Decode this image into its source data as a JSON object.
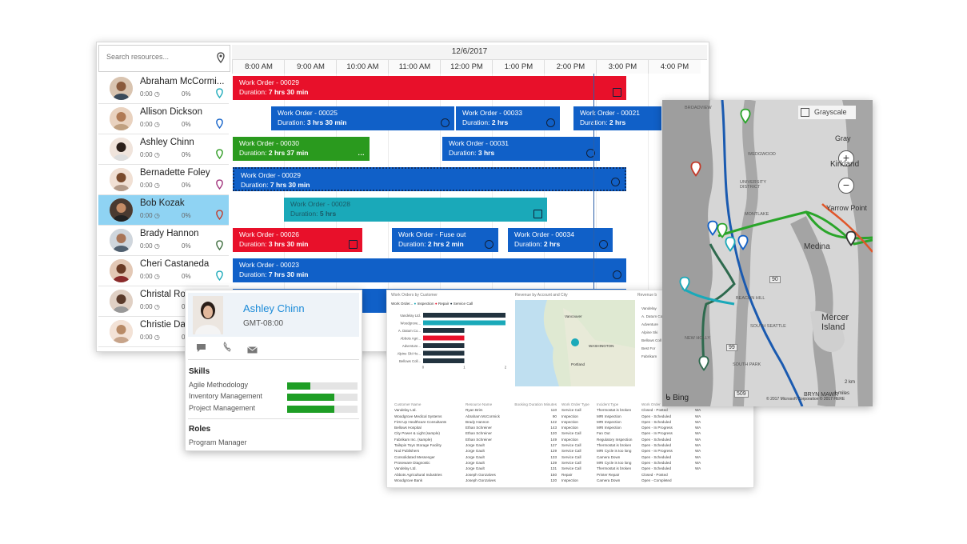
{
  "board": {
    "search_placeholder": "Search resources...",
    "date": "12/6/2017",
    "hours": [
      "8:00 AM",
      "9:00 AM",
      "10:00 AM",
      "11:00 AM",
      "12:00 PM",
      "1:00 PM",
      "2:00 PM",
      "3:00 PM",
      "4:00 PM"
    ],
    "resources": [
      {
        "name": "Abraham McCormi...",
        "hours": "0:00",
        "pct": "0%",
        "pin_color": "#1aa9b9"
      },
      {
        "name": "Allison Dickson",
        "hours": "0:00",
        "pct": "0%",
        "pin_color": "#1060c8"
      },
      {
        "name": "Ashley Chinn",
        "hours": "0:00",
        "pct": "0%",
        "pin_color": "#2a9a1e"
      },
      {
        "name": "Bernadette Foley",
        "hours": "0:00",
        "pct": "0%",
        "pin_color": "#a0307a"
      },
      {
        "name": "Bob Kozak",
        "hours": "0:00",
        "pct": "0%",
        "pin_color": "#c23a2a"
      },
      {
        "name": "Brady Hannon",
        "hours": "0:00",
        "pct": "0%",
        "pin_color": "#3a6a3a"
      },
      {
        "name": "Cheri Castaneda",
        "hours": "0:00",
        "pct": "0%",
        "pin_color": "#1aa9b9"
      },
      {
        "name": "Christal Rob",
        "hours": "0:00",
        "pct": "0%",
        "pin_color": "#1060c8"
      },
      {
        "name": "Christie Day",
        "hours": "0:00",
        "pct": "0%",
        "pin_color": "#1060c8"
      }
    ],
    "bookings": [
      {
        "title": "Work Order - 00029",
        "duration_label": "Duration:",
        "duration": "7 hrs 30 min"
      },
      {
        "title": "Work Order - 00025",
        "duration_label": "Duration:",
        "duration": "3 hrs 30 min"
      },
      {
        "title": "Work Order - 00033",
        "duration_label": "Duration:",
        "duration": "2 hrs"
      },
      {
        "title": "Work Order - 00021",
        "duration_label": "Duration:",
        "duration": "2 hrs"
      },
      {
        "title": "Work Order - 00030",
        "duration_label": "Duration:",
        "duration": "2 hrs 37 min"
      },
      {
        "title": "Work Order - 00031",
        "duration_label": "Duration:",
        "duration": "3 hrs"
      },
      {
        "title": "Work Order - 00029",
        "duration_label": "Duration:",
        "duration": "7 hrs 30 min"
      },
      {
        "title": "Work Order - 00028",
        "duration_label": "Duration:",
        "duration": "5 hrs"
      },
      {
        "title": "Work Order - 00026",
        "duration_label": "Duration:",
        "duration": "3 hrs 30 min"
      },
      {
        "title": "Work Order - Fuse out",
        "duration_label": "Duration:",
        "duration": "2 hrs 2 min"
      },
      {
        "title": "Work Order - 00034",
        "duration_label": "Duration:",
        "duration": "2 hrs"
      },
      {
        "title": "Work Order - 00023",
        "duration_label": "Duration:",
        "duration": "7 hrs 30 min"
      }
    ],
    "colors": {
      "red": "#e8102a",
      "blue": "#1060c8",
      "green": "#2a9a1e",
      "teal": "#1aa9b9",
      "selected_row": "#8fd3f3"
    }
  },
  "card": {
    "name": "Ashley Chinn",
    "timezone": "GMT-08:00",
    "skills_heading": "Skills",
    "skills": [
      {
        "name": "Agile Methodology",
        "level": 0.33
      },
      {
        "name": "Inventory Management",
        "level": 0.67
      },
      {
        "name": "Project Management",
        "level": 0.67
      }
    ],
    "roles_heading": "Roles",
    "roles": [
      "Program Manager"
    ],
    "icons": [
      "chat-icon",
      "phone-icon",
      "mail-icon"
    ]
  },
  "report": {
    "chart1_title": "Work Orders by Customer",
    "legend_label": "Work Order...",
    "legend": [
      {
        "name": "Inspection",
        "color": "#1aa9b9"
      },
      {
        "name": "Repair",
        "color": "#e8102a"
      },
      {
        "name": "Service Call",
        "color": "#22333f"
      }
    ],
    "chart_data": {
      "type": "bar",
      "orientation": "horizontal",
      "categories": [
        "Vandelay Ltd.",
        "Woodgrove...",
        "A. Datum Co...",
        "Abbots Agri...",
        "Adventure...",
        "Alpine Ski Ho...",
        "Bellows Coll..."
      ],
      "values": [
        2,
        2,
        1,
        1,
        1,
        1,
        1
      ],
      "colors": [
        "#22333f",
        "#1aa9b9",
        "#22333f",
        "#e8102a",
        "#22333f",
        "#22333f",
        "#22333f"
      ],
      "xticks": [
        "0",
        "1",
        "2"
      ],
      "xlim": [
        0,
        2
      ]
    },
    "chart2_title": "Revenue by Account and City",
    "chart3_title": "Revenue b",
    "map_labels": [
      "Vancouver",
      "WASHINGTON",
      "Portland"
    ],
    "right_list": [
      "Vandelay",
      "A. Datum Co",
      "Adventure",
      "Alpine Ski",
      "Bellows Coll",
      "Best For",
      "Fabrikam"
    ],
    "table_headers": [
      "Customer Name",
      "Resource Name",
      "Booking Duration Minutes",
      "Work Order Type",
      "Incident Type",
      "Work Order"
    ],
    "table_rows": [
      [
        "Vandelay Ltd.",
        "Ryan Brim",
        "110",
        "Service Call",
        "Thermostat is broken",
        "Closed - Posted",
        ""
      ],
      [
        "Woodgrove Medical Systems",
        "Abraham McCormick",
        "90",
        "Inspection",
        "MRI Inspection",
        "Open - Scheduled",
        ""
      ],
      [
        "First Up Healthcare Consultants",
        "Brady Hannon",
        "122",
        "Inspection",
        "MRI Inspection",
        "Open - Scheduled",
        "WA"
      ],
      [
        "Bellows Hospital",
        "Ethan Schreiner",
        "143",
        "Inspection",
        "MRI Inspection",
        "Open - In Progress",
        "WA"
      ],
      [
        "City Power & Light (sample)",
        "Ethan Schreiner",
        "120",
        "Service Call",
        "Fan Out",
        "Open - In Progress",
        "WA"
      ],
      [
        "Fabrikam Inc. (sample)",
        "Ethan Schreiner",
        "149",
        "Inspection",
        "Regulatory Inspection",
        "Open - Scheduled",
        "WA"
      ],
      [
        "Tailspin Toys Storage Facility",
        "Jorge Gault",
        "127",
        "Service Call",
        "Thermostat is broken",
        "Open - Scheduled",
        "WA"
      ],
      [
        "Nod Publishers",
        "Jorge Gault",
        "129",
        "Service Call",
        "MRI Cycle is too long",
        "Open - In Progress",
        "WA"
      ],
      [
        "Consolidated Messenger",
        "Jorge Gault",
        "133",
        "Service Call",
        "Camera Down",
        "Open - Scheduled",
        "WA"
      ],
      [
        "Proseware Diagnostic",
        "Jorge Gault",
        "139",
        "Service Call",
        "MRI Cycle is too long",
        "Open - Scheduled",
        "WA"
      ],
      [
        "Vandelay Ltd.",
        "Jorge Gault",
        "131",
        "Service Call",
        "Thermostat is broken",
        "Open - Scheduled",
        "WA"
      ],
      [
        "Abbots Agricultural Industries",
        "Joseph Gonzalves",
        "150",
        "Repair",
        "Printer Repair",
        "Closed - Posted",
        "WA"
      ],
      [
        "Woodgrove Bank",
        "Joseph Gonzalves",
        "120",
        "Inspection",
        "Camera Down",
        "Open - Completed",
        "WA"
      ]
    ]
  },
  "map": {
    "grayscale_label": "Grayscale",
    "places": [
      "BROADVIEW",
      "Gray",
      "Kirkland",
      "WEDGWOOD",
      "UNIVERSITY DISTRICT",
      "MONTLAKE",
      "Yarrow Point",
      "Medina",
      "BEACON HILL",
      "SOUTH SEATTLE",
      "Mercer Island",
      "NEW HOLLY",
      "SOUTH PARK",
      "BRYN MAWR"
    ],
    "roads": [
      "90",
      "99",
      "509"
    ],
    "scale_label": "2 km",
    "scale_label2": "1 miles",
    "bing_label": "Bing",
    "copyright": "© 2017 Microsoft Corporation © 2017 HERE"
  }
}
